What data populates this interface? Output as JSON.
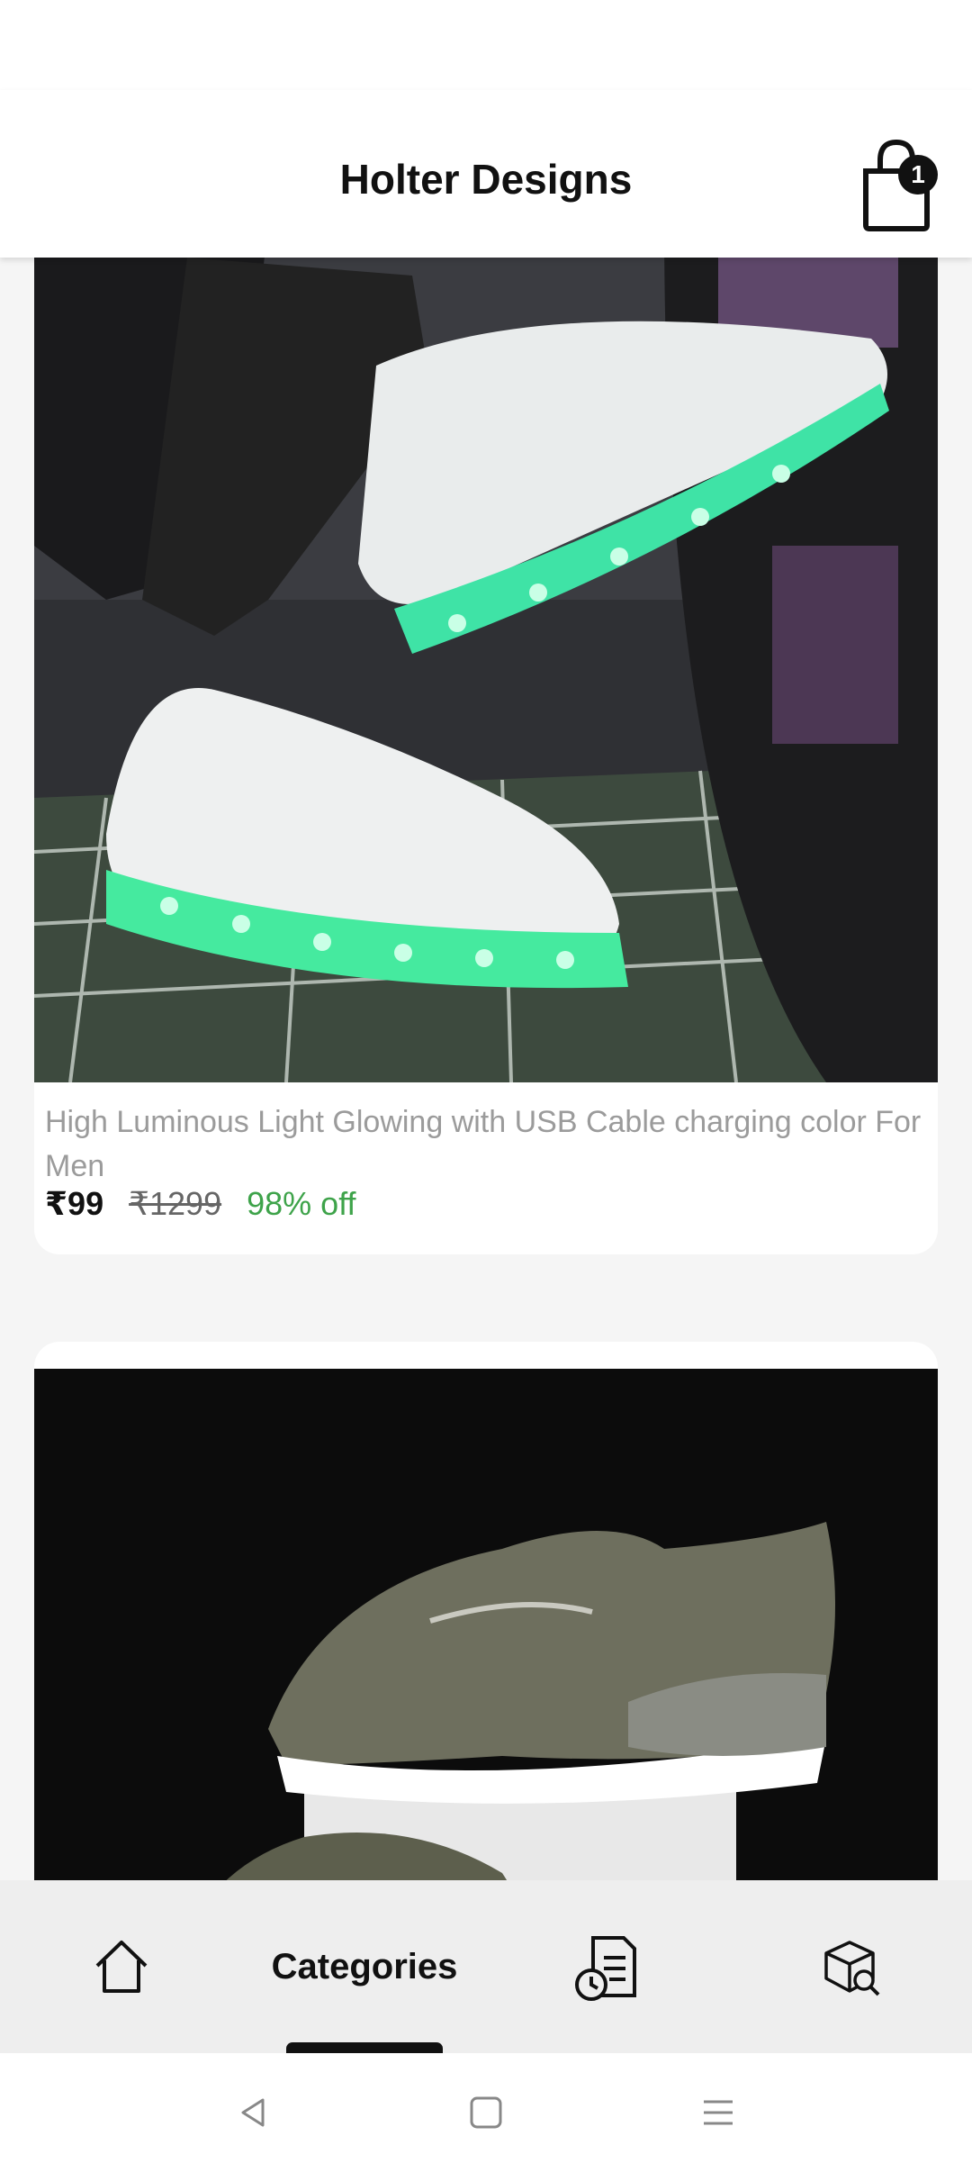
{
  "header": {
    "title": "Holter Designs",
    "cart_count": "1",
    "cart_icon": "shopping-bag-icon"
  },
  "products": [
    {
      "title": "High Luminous Light Glowing with USB Cable charging color For Men",
      "price": "₹99",
      "original_price": "₹1299",
      "discount": "98% off",
      "image": "white-led-sneakers-photo"
    },
    {
      "title": "",
      "image": "olive-running-sneakers-photo"
    }
  ],
  "bottom_nav": {
    "items": [
      {
        "icon": "home-icon"
      },
      {
        "label": "Categories"
      },
      {
        "icon": "orders-history-icon"
      },
      {
        "icon": "package-search-icon"
      }
    ],
    "active": "Categories"
  },
  "system_nav": {
    "icons": [
      "back-icon",
      "recents-square-icon",
      "menu-icon"
    ]
  },
  "colors": {
    "discount": "#3ea34a",
    "nav_bg": "#eeeeee",
    "accent": "#111111"
  }
}
